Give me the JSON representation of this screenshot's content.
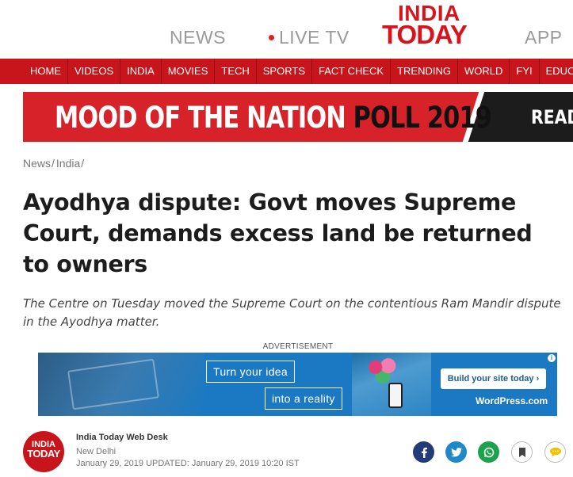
{
  "header": {
    "news_link": "NEWS",
    "live_tv_link": "LIVE TV",
    "app_link": "APP",
    "logo_line1": "INDIA",
    "logo_line2": "TODAY"
  },
  "nav": {
    "items": [
      "HOME",
      "VIDEOS",
      "INDIA",
      "MOVIES",
      "TECH",
      "SPORTS",
      "FACT CHECK",
      "TRENDING",
      "WORLD",
      "FYI",
      "EDUCATION"
    ]
  },
  "banner": {
    "text_main": "MOOD OF THE NATION",
    "text_poll": "POLL 2019",
    "read_label": "READ"
  },
  "breadcrumb": {
    "items": [
      "News",
      "India"
    ],
    "separator": "/"
  },
  "article": {
    "headline": "Ayodhya dispute: Govt moves Supreme Court, demands excess land be returned to owners",
    "summary": "The Centre on Tuesday moved the Supreme Court on the contentious Ram Mandir dispute in the Ayodhya matter."
  },
  "advertisement": {
    "label": "ADVERTISEMENT",
    "line1": "Turn your idea",
    "line2": "into a reality",
    "cta": "Build your site today ›",
    "brand": "WordPress.com",
    "info_icon": "info-icon"
  },
  "author": {
    "avatar_line1": "INDIA",
    "avatar_line2": "TODAY",
    "name": "India Today Web Desk",
    "location": "New Delhi",
    "dateline": "January 29, 2019  UPDATED: January 29, 2019 10:20 IST"
  },
  "share": {
    "icons": [
      "facebook-icon",
      "twitter-icon",
      "whatsapp-icon",
      "bookmark-icon",
      "comment-icon"
    ]
  },
  "colors": {
    "brand_red": "#c8141b",
    "banner_red": "#d8222a",
    "facebook": "#243b7a",
    "twitter": "#1e88c8",
    "whatsapp": "#1aa34a",
    "ad_blue": "#1a79c2"
  }
}
